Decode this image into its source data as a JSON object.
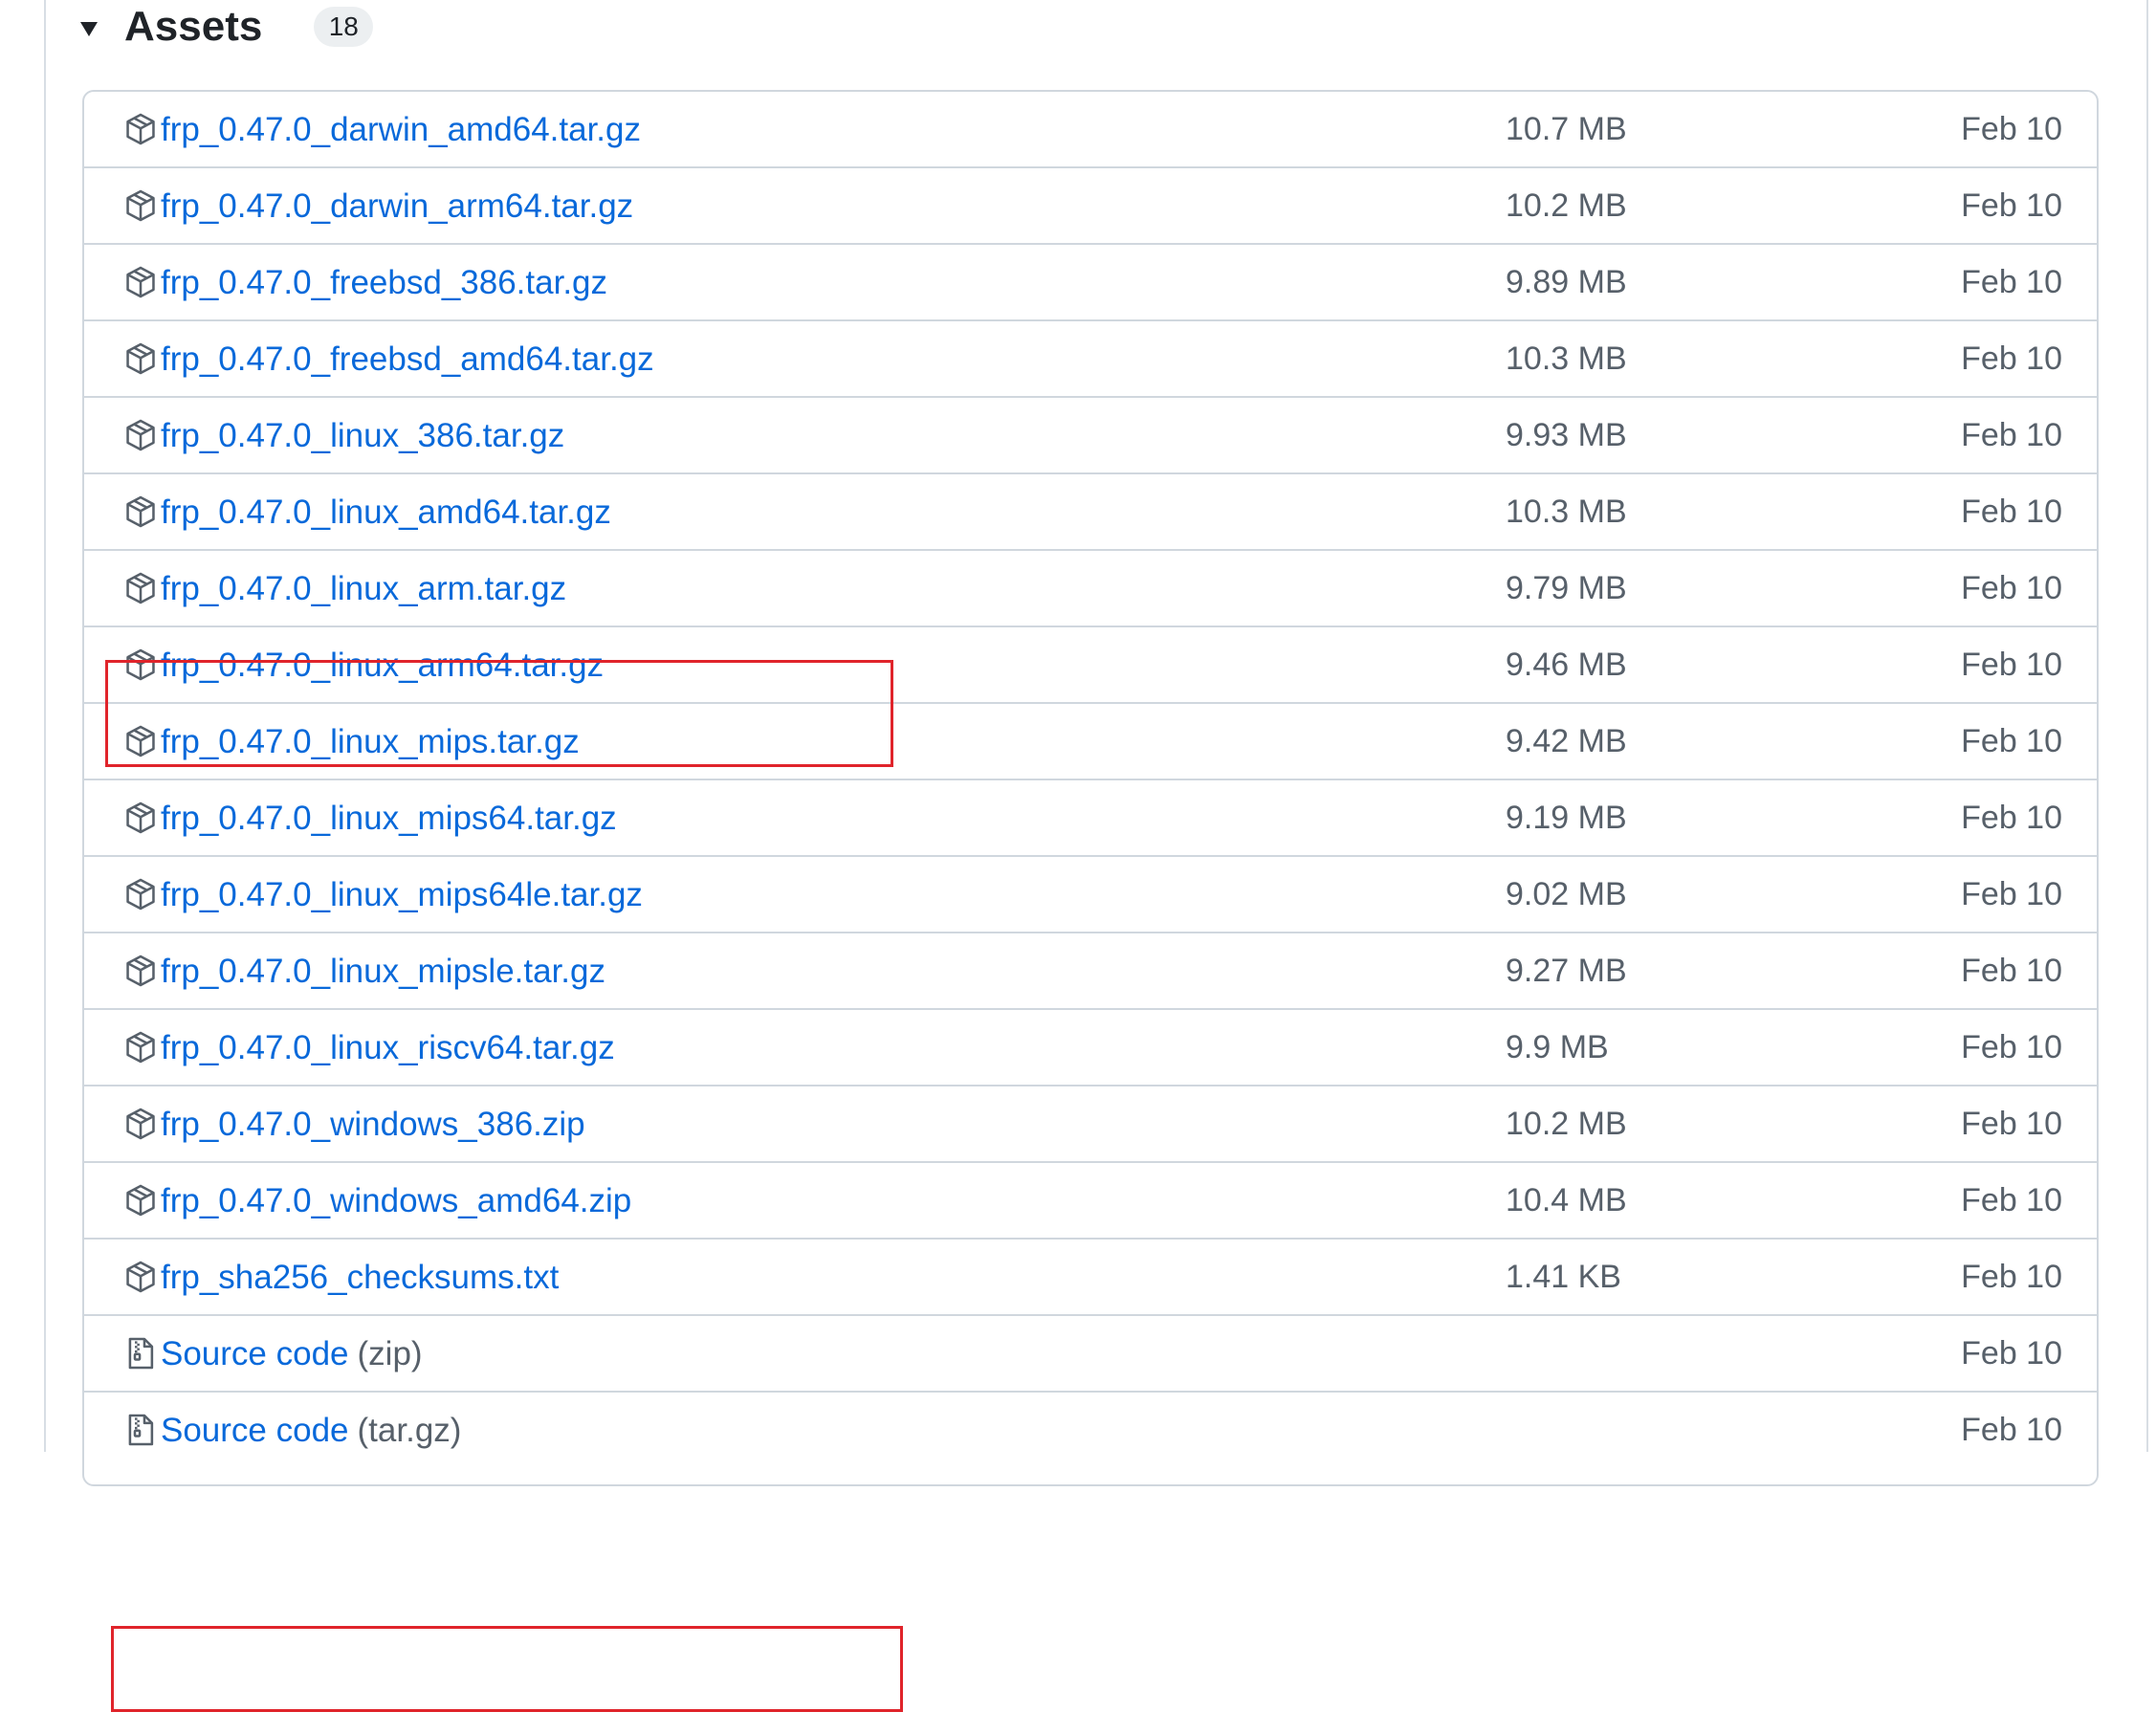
{
  "assets": {
    "title": "Assets",
    "count": "18",
    "items": [
      {
        "name": "frp_0.47.0_darwin_amd64.tar.gz",
        "suffix": "",
        "size": "10.7 MB",
        "date": "Feb 10",
        "icon": "package-icon"
      },
      {
        "name": "frp_0.47.0_darwin_arm64.tar.gz",
        "suffix": "",
        "size": "10.2 MB",
        "date": "Feb 10",
        "icon": "package-icon"
      },
      {
        "name": "frp_0.47.0_freebsd_386.tar.gz",
        "suffix": "",
        "size": "9.89 MB",
        "date": "Feb 10",
        "icon": "package-icon"
      },
      {
        "name": "frp_0.47.0_freebsd_amd64.tar.gz",
        "suffix": "",
        "size": "10.3 MB",
        "date": "Feb 10",
        "icon": "package-icon"
      },
      {
        "name": "frp_0.47.0_linux_386.tar.gz",
        "suffix": "",
        "size": "9.93 MB",
        "date": "Feb 10",
        "icon": "package-icon"
      },
      {
        "name": "frp_0.47.0_linux_amd64.tar.gz",
        "suffix": "",
        "size": "10.3 MB",
        "date": "Feb 10",
        "icon": "package-icon",
        "highlighted": true
      },
      {
        "name": "frp_0.47.0_linux_arm.tar.gz",
        "suffix": "",
        "size": "9.79 MB",
        "date": "Feb 10",
        "icon": "package-icon"
      },
      {
        "name": "frp_0.47.0_linux_arm64.tar.gz",
        "suffix": "",
        "size": "9.46 MB",
        "date": "Feb 10",
        "icon": "package-icon"
      },
      {
        "name": "frp_0.47.0_linux_mips.tar.gz",
        "suffix": "",
        "size": "9.42 MB",
        "date": "Feb 10",
        "icon": "package-icon"
      },
      {
        "name": "frp_0.47.0_linux_mips64.tar.gz",
        "suffix": "",
        "size": "9.19 MB",
        "date": "Feb 10",
        "icon": "package-icon"
      },
      {
        "name": "frp_0.47.0_linux_mips64le.tar.gz",
        "suffix": "",
        "size": "9.02 MB",
        "date": "Feb 10",
        "icon": "package-icon"
      },
      {
        "name": "frp_0.47.0_linux_mipsle.tar.gz",
        "suffix": "",
        "size": "9.27 MB",
        "date": "Feb 10",
        "icon": "package-icon"
      },
      {
        "name": "frp_0.47.0_linux_riscv64.tar.gz",
        "suffix": "",
        "size": "9.9 MB",
        "date": "Feb 10",
        "icon": "package-icon"
      },
      {
        "name": "frp_0.47.0_windows_386.zip",
        "suffix": "",
        "size": "10.2 MB",
        "date": "Feb 10",
        "icon": "package-icon"
      },
      {
        "name": "frp_0.47.0_windows_amd64.zip",
        "suffix": "",
        "size": "10.4 MB",
        "date": "Feb 10",
        "icon": "package-icon",
        "highlighted": true
      },
      {
        "name": "frp_sha256_checksums.txt",
        "suffix": "",
        "size": "1.41 KB",
        "date": "Feb 10",
        "icon": "package-icon"
      },
      {
        "name": "Source code",
        "suffix": "(zip)",
        "size": "",
        "date": "Feb 10",
        "icon": "file-zip-icon"
      },
      {
        "name": "Source code",
        "suffix": "(tar.gz)",
        "size": "",
        "date": "Feb 10",
        "icon": "file-zip-icon"
      }
    ]
  },
  "colors": {
    "link": "#0969da",
    "muted": "#57606a",
    "border": "#d0d7de",
    "highlight": "#e0242b"
  }
}
